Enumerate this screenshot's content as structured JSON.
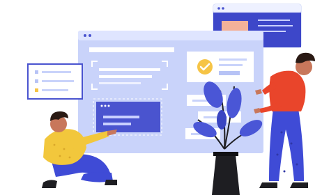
{
  "illustration": {
    "colors": {
      "background": "#ffffff",
      "panel_light": "#c9d3fa",
      "panel_mid": "#b7c3f6",
      "panel_border": "#aab8f2",
      "accent_blue": "#4a54cf",
      "accent_dark_blue": "#2f36a6",
      "white_card": "#ffffff",
      "check_yellow": "#f6c445",
      "peach": "#f3b199",
      "shirt_orange": "#e9452b",
      "shirt_yellow": "#f2c73c",
      "pants_blue": "#3f4bd6",
      "skin": "#c8775b",
      "hair": "#2a1a14",
      "vase": "#1e1e22",
      "leaf": "#4a56d6"
    },
    "icons": [
      "check-icon",
      "list-icon",
      "window-dots-icon",
      "plant-icon"
    ]
  }
}
